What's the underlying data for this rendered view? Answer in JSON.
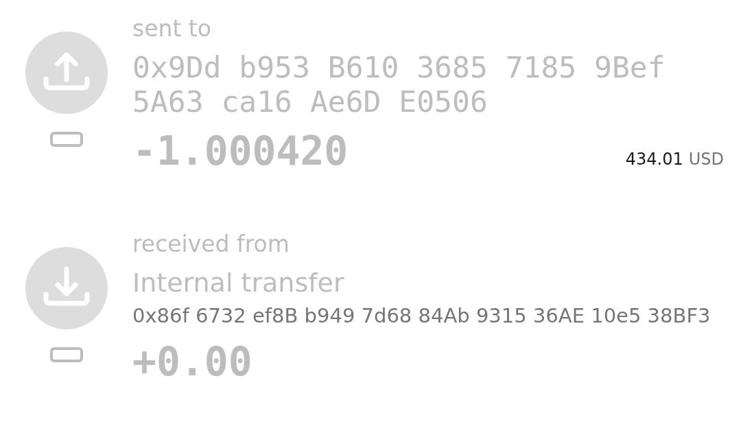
{
  "transactions": [
    {
      "kind": "sent",
      "direction": "sent to",
      "address": "0x9Dd b953 B610 3685 7185 9Bef 5A63 ca16 Ae6D E0506",
      "amount": "-1.000420",
      "fiat_value": "434.01",
      "fiat_currency": "USD"
    },
    {
      "kind": "received",
      "direction": "received from",
      "name": "Internal transfer",
      "address": "0x86f 6732 ef8B b949 7d68 84Ab 9315 36AE 10e5 38BF3",
      "amount": "+0.00"
    }
  ]
}
